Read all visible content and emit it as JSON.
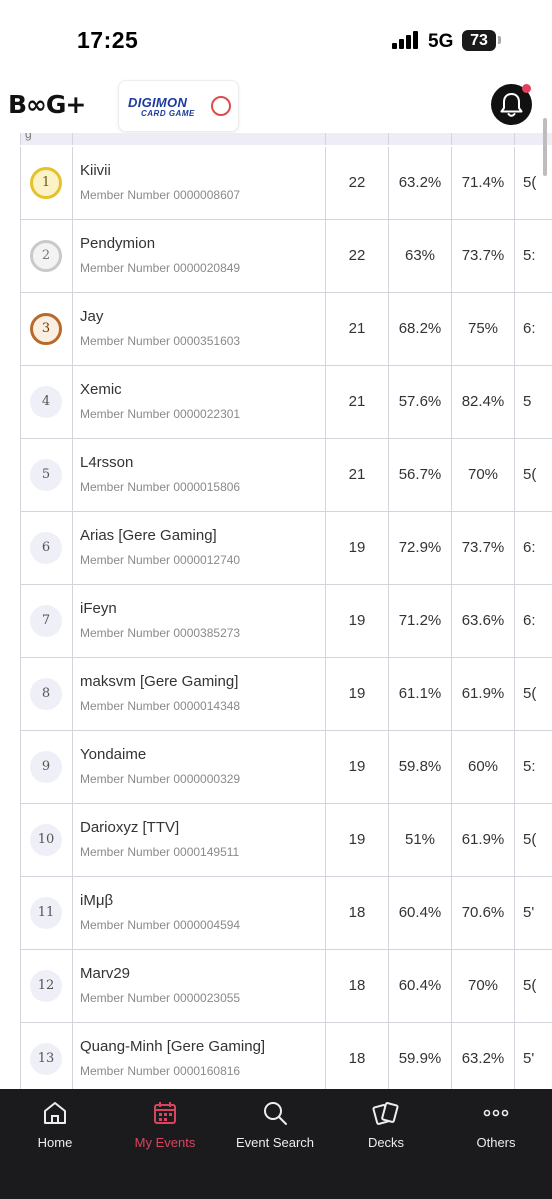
{
  "status_bar": {
    "time": "17:25",
    "network": "5G",
    "battery": "73"
  },
  "header": {
    "logo_text": "B∞G+",
    "game_logo": {
      "title": "DIGIMON",
      "subtitle": "CARD GAME"
    },
    "notification_badge": true,
    "accent_color": "#e0405a"
  },
  "table": {
    "header_partial": "g",
    "rows": [
      {
        "rank": "1",
        "medal": "gold",
        "name": "Kiivii",
        "member": "Member Number 0000008607",
        "points": "22",
        "omw": "63.2%",
        "gw": "71.4%",
        "ogw": "5("
      },
      {
        "rank": "2",
        "medal": "silver",
        "name": "Pendymion",
        "member": "Member Number 0000020849",
        "points": "22",
        "omw": "63%",
        "gw": "73.7%",
        "ogw": "5:"
      },
      {
        "rank": "3",
        "medal": "bronze",
        "name": "Jay",
        "member": "Member Number 0000351603",
        "points": "21",
        "omw": "68.2%",
        "gw": "75%",
        "ogw": "6:"
      },
      {
        "rank": "4",
        "medal": "none",
        "name": "Xemic",
        "member": "Member Number 0000022301",
        "points": "21",
        "omw": "57.6%",
        "gw": "82.4%",
        "ogw": "5"
      },
      {
        "rank": "5",
        "medal": "none",
        "name": "L4rsson",
        "member": "Member Number 0000015806",
        "points": "21",
        "omw": "56.7%",
        "gw": "70%",
        "ogw": "5("
      },
      {
        "rank": "6",
        "medal": "none",
        "name": "Arias [Gere Gaming]",
        "member": "Member Number 0000012740",
        "points": "19",
        "omw": "72.9%",
        "gw": "73.7%",
        "ogw": "6:"
      },
      {
        "rank": "7",
        "medal": "none",
        "name": "iFeyn",
        "member": "Member Number 0000385273",
        "points": "19",
        "omw": "71.2%",
        "gw": "63.6%",
        "ogw": "6:"
      },
      {
        "rank": "8",
        "medal": "none",
        "name": "maksvm [Gere Gaming]",
        "member": "Member Number 0000014348",
        "points": "19",
        "omw": "61.1%",
        "gw": "61.9%",
        "ogw": "5("
      },
      {
        "rank": "9",
        "medal": "none",
        "name": "Yondaime",
        "member": "Member Number 0000000329",
        "points": "19",
        "omw": "59.8%",
        "gw": "60%",
        "ogw": "5:"
      },
      {
        "rank": "10",
        "medal": "none",
        "name": "Darioxyz [TTV]",
        "member": "Member Number 0000149511",
        "points": "19",
        "omw": "51%",
        "gw": "61.9%",
        "ogw": "5("
      },
      {
        "rank": "11",
        "medal": "none",
        "name": "iMμβ",
        "member": "Member Number 0000004594",
        "points": "18",
        "omw": "60.4%",
        "gw": "70.6%",
        "ogw": "5'"
      },
      {
        "rank": "12",
        "medal": "none",
        "name": "Marv29",
        "member": "Member Number 0000023055",
        "points": "18",
        "omw": "60.4%",
        "gw": "70%",
        "ogw": "5("
      },
      {
        "rank": "13",
        "medal": "none",
        "name": "Quang-Minh [Gere Gaming]",
        "member": "Member Number 0000160816",
        "points": "18",
        "omw": "59.9%",
        "gw": "63.2%",
        "ogw": "5'"
      }
    ]
  },
  "bottom_nav": {
    "items": [
      {
        "label": "Home",
        "icon": "home-icon",
        "active": false
      },
      {
        "label": "My Events",
        "icon": "calendar-icon",
        "active": true
      },
      {
        "label": "Event Search",
        "icon": "search-icon",
        "active": false
      },
      {
        "label": "Decks",
        "icon": "cards-icon",
        "active": false
      },
      {
        "label": "Others",
        "icon": "more-icon",
        "active": false
      }
    ],
    "active_color": "#d9445f"
  }
}
